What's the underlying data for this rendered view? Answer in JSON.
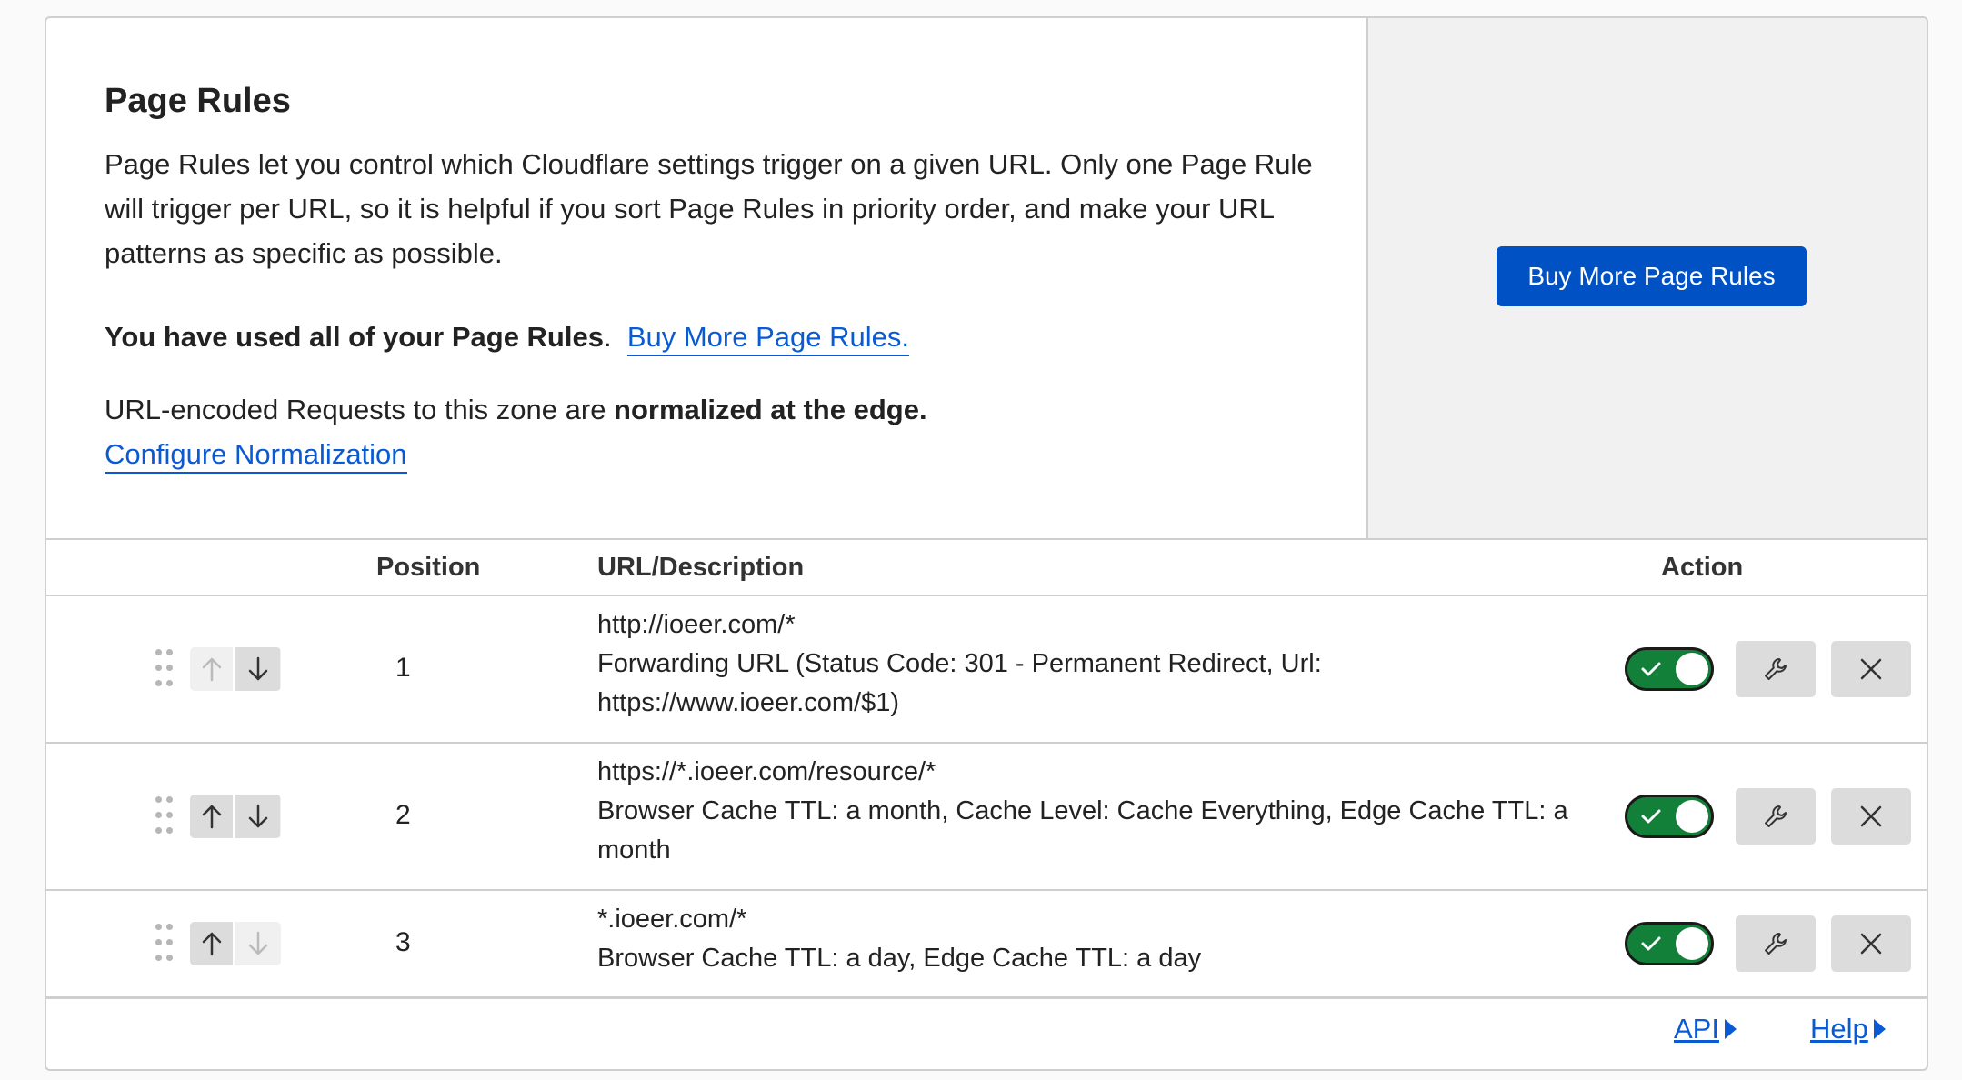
{
  "header": {
    "title": "Page Rules",
    "description": "Page Rules let you control which Cloudflare settings trigger on a given URL. Only one Page Rule will trigger per URL, so it is helpful if you sort Page Rules in priority order, and make your URL patterns as specific as possible.",
    "used_text": "You have used all of your Page Rules",
    "used_suffix": ".",
    "buy_link": "Buy More Page Rules.",
    "normalization_prefix": "URL-encoded Requests to this zone are ",
    "normalization_bold": "normalized at the edge.",
    "configure_link": "Configure Normalization",
    "buy_button": "Buy More Page Rules"
  },
  "table": {
    "columns": [
      "Position",
      "URL/Description",
      "Action"
    ],
    "rows": [
      {
        "position": "1",
        "url": "http://ioeer.com/*",
        "description": "Forwarding URL (Status Code: 301 - Permanent Redirect, Url: https://www.ioeer.com/$1)",
        "enabled": true,
        "up_enabled": false,
        "down_enabled": true
      },
      {
        "position": "2",
        "url": "https://*.ioeer.com/resource/*",
        "description": "Browser Cache TTL: a month, Cache Level: Cache Everything, Edge Cache TTL: a month",
        "enabled": true,
        "up_enabled": true,
        "down_enabled": true
      },
      {
        "position": "3",
        "url": "*.ioeer.com/*",
        "description": "Browser Cache TTL: a day, Edge Cache TTL: a day",
        "enabled": true,
        "up_enabled": true,
        "down_enabled": false
      }
    ]
  },
  "footer": {
    "api_link": "API",
    "help_link": "Help"
  },
  "colors": {
    "accent": "#0051c3",
    "link": "#0a5ad4",
    "toggle_on": "#128038"
  },
  "icons": [
    "drag-handle-icon",
    "arrow-up-icon",
    "arrow-down-icon",
    "check-icon",
    "wrench-icon",
    "close-icon",
    "triangle-right-icon"
  ]
}
